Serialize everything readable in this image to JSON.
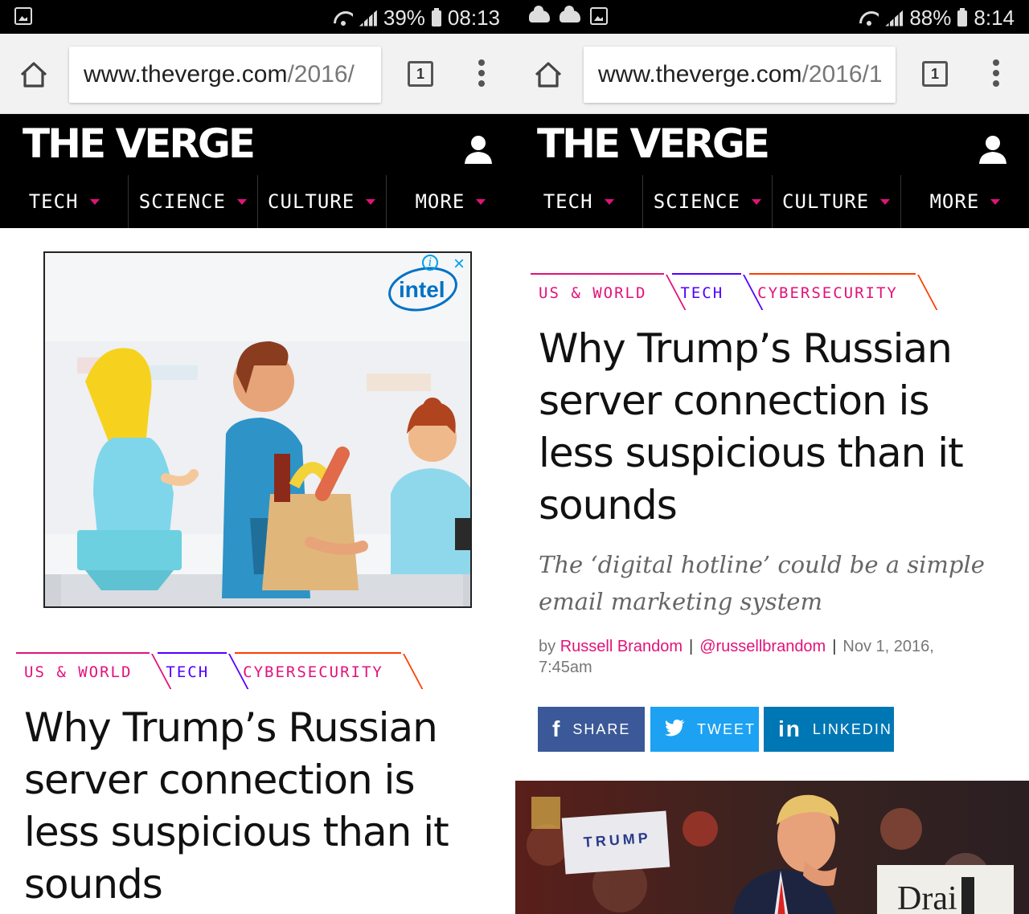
{
  "left": {
    "status": {
      "battery": "39%",
      "time": "08:13"
    },
    "browser": {
      "url_domain": "www.theverge.com",
      "url_path": "/2016/",
      "tab_count": "1"
    },
    "verge": {
      "logo": "THE VERGE",
      "nav": [
        "TECH",
        "SCIENCE",
        "CULTURE",
        "MORE"
      ]
    },
    "ad": {
      "brand": "intel",
      "info": "i",
      "close": "×"
    },
    "tags": [
      "US & WORLD",
      "TECH",
      "CYBERSECURITY"
    ],
    "headline": [
      "Why Trump’s Russian",
      "server connection is",
      "less suspicious than it",
      "sounds"
    ]
  },
  "right": {
    "status": {
      "battery": "88%",
      "time": "8:14"
    },
    "browser": {
      "url_domain": "www.theverge.com",
      "url_path": "/2016/1",
      "tab_count": "1"
    },
    "verge": {
      "logo": "THE VERGE",
      "nav": [
        "TECH",
        "SCIENCE",
        "CULTURE",
        "MORE"
      ]
    },
    "tags": [
      "US & WORLD",
      "TECH",
      "CYBERSECURITY"
    ],
    "headline": [
      "Why Trump’s Russian",
      "server connection is",
      "less suspicious than it",
      "sounds"
    ],
    "dek": [
      "The ‘digital hotline’ could be a simple",
      "email marketing system"
    ],
    "byline": {
      "by": "by",
      "author": "Russell Brandom",
      "handle": "@russellbrandom",
      "date": "Nov 1, 2016,",
      "time": "7:45am"
    },
    "share": {
      "facebook": "SHARE",
      "twitter": "TWEET",
      "linkedin": "LINKEDIN"
    },
    "photo_text": {
      "sign1": "TRUMP",
      "sign2": "Drai"
    }
  },
  "colors": {
    "accent": "#e2127a",
    "purple": "#5200ff",
    "orange": "#ff3d00",
    "facebook": "#3b5998",
    "twitter": "#1da1f2",
    "linkedin": "#0077b5"
  }
}
